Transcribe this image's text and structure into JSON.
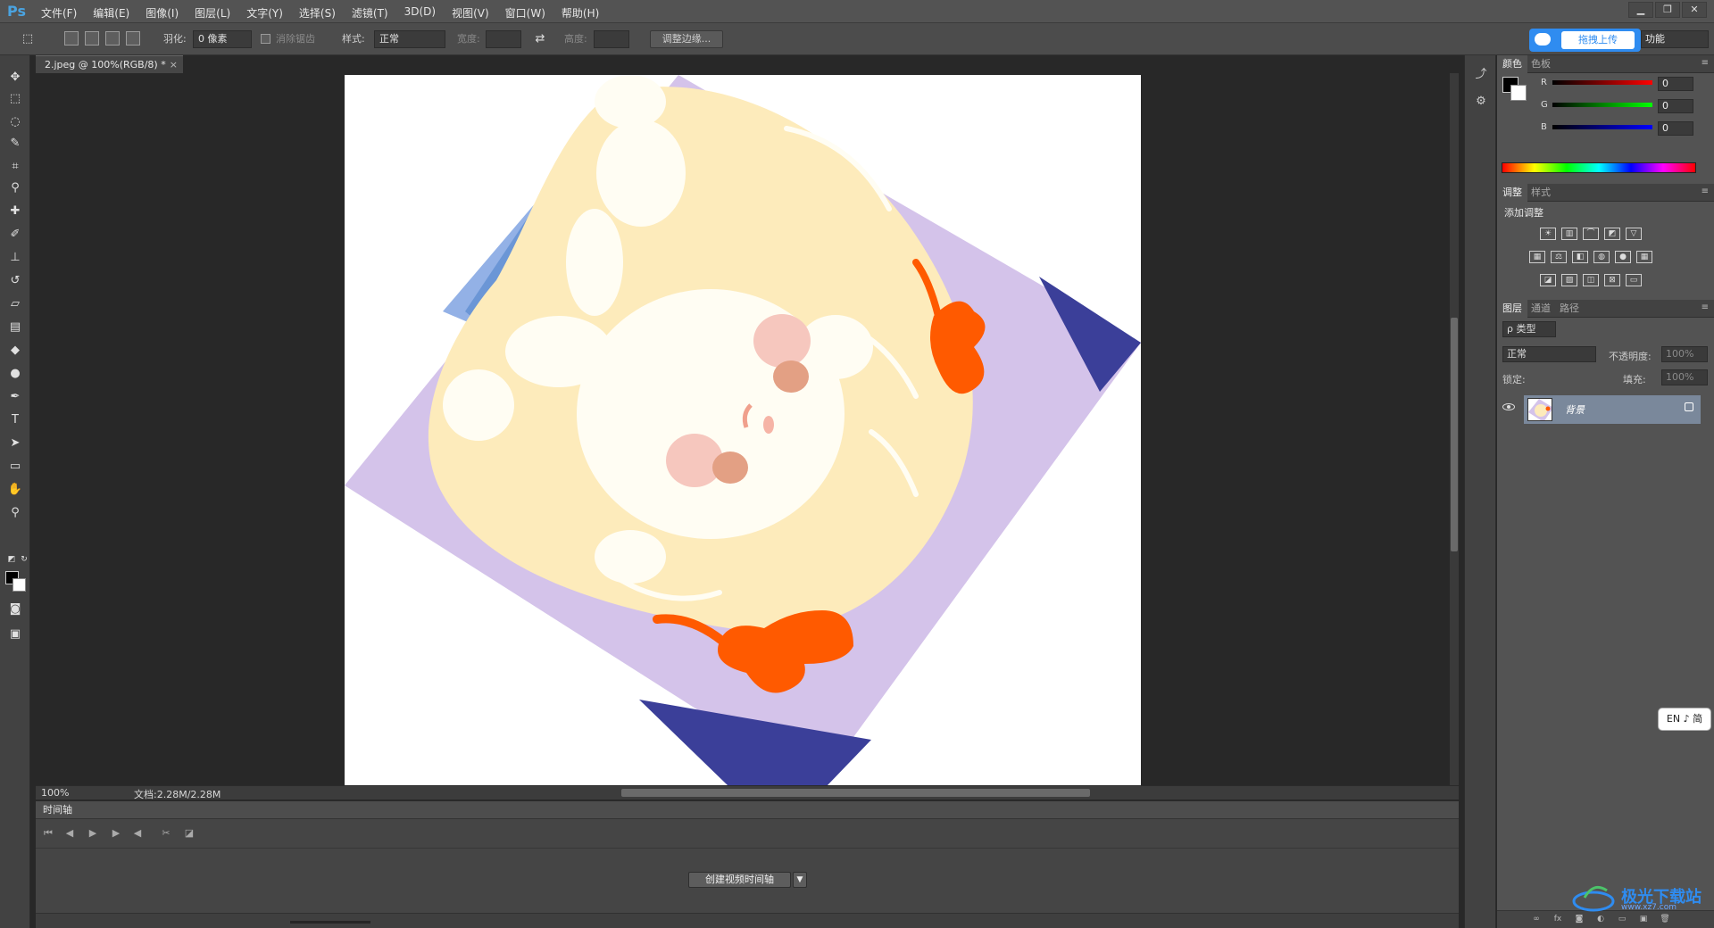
{
  "app": {
    "logo": "Ps"
  },
  "menu": [
    "文件(F)",
    "编辑(E)",
    "图像(I)",
    "图层(L)",
    "文字(Y)",
    "选择(S)",
    "滤镜(T)",
    "3D(D)",
    "视图(V)",
    "窗口(W)",
    "帮助(H)"
  ],
  "window_controls": {
    "minimize": "▁",
    "restore": "❐",
    "close": "✕"
  },
  "options": {
    "feather_label": "羽化:",
    "feather_value": "0 像素",
    "antialias_label": "消除锯齿",
    "style_label": "样式:",
    "style_value": "正常",
    "width_label": "宽度:",
    "height_label": "高度:",
    "refine_edge": "调整边缘...",
    "upload_label": "拖拽上传",
    "workspace": "功能"
  },
  "document": {
    "tab_title": "2.jpeg @ 100%(RGB/8) *",
    "zoom": "100%",
    "doc_info": "文档:2.28M/2.28M"
  },
  "timeline": {
    "title": "时间轴",
    "create_button": "创建视频时间轴"
  },
  "color_panel": {
    "tabs": [
      "颜色",
      "色板"
    ],
    "r_label": "R",
    "r_value": "0",
    "g_label": "G",
    "g_value": "0",
    "b_label": "B",
    "b_value": "0",
    "foreground": "#000000",
    "background": "#ffffff"
  },
  "adjust_panel": {
    "tabs": [
      "调整",
      "样式"
    ],
    "title": "添加调整"
  },
  "layers_panel": {
    "tabs": [
      "图层",
      "通道",
      "路径"
    ],
    "filter": "ρ 类型",
    "blend_mode": "正常",
    "opacity_label": "不透明度:",
    "opacity_value": "100%",
    "lock_label": "锁定:",
    "fill_label": "填充:",
    "fill_value": "100%",
    "layers": [
      {
        "name": "背景",
        "visible": true,
        "locked": true
      }
    ]
  },
  "ime": "EN ♪ 简",
  "watermark": {
    "text": "极光下载站",
    "sub": "www.xz7.com"
  },
  "colors": {
    "accent": "#2f8cf0",
    "lavender": "#d4c3ea",
    "hair": "#fdebbb",
    "skin": "#fffdf3",
    "orange_bow": "#ff5a00",
    "navy": "#3b3f99",
    "blue": "#7ea8e2"
  }
}
